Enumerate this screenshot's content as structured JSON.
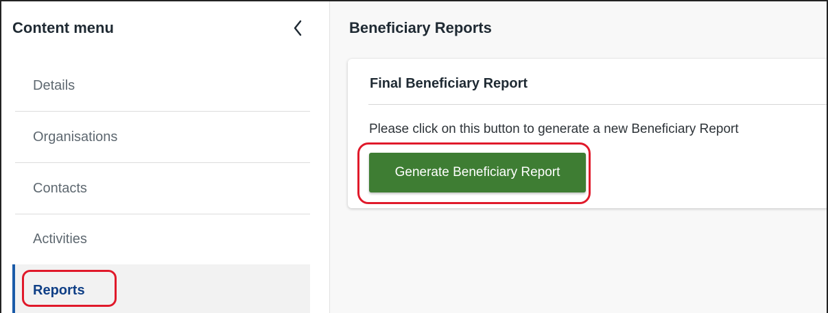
{
  "sidebar": {
    "title": "Content menu",
    "collapse_icon": "chevron-left-icon",
    "items": [
      {
        "label": "Details",
        "active": false
      },
      {
        "label": "Organisations",
        "active": false
      },
      {
        "label": "Contacts",
        "active": false
      },
      {
        "label": "Activities",
        "active": false
      },
      {
        "label": "Reports",
        "active": true
      }
    ]
  },
  "main": {
    "title": "Beneficiary Reports",
    "card": {
      "title": "Final Beneficiary Report",
      "description": "Please click on this button to generate a new Beneficiary Report",
      "button_label": "Generate Beneficiary Report"
    }
  },
  "colors": {
    "accent": "#1a5aa8",
    "button": "#3e7d33",
    "annotation": "#e0192a"
  }
}
